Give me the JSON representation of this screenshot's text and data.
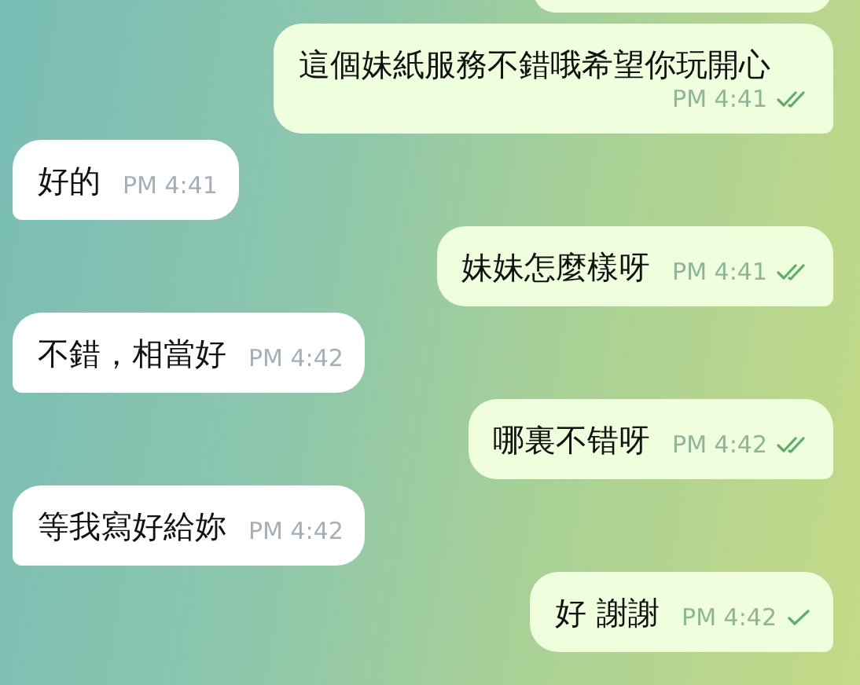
{
  "messages": [
    {
      "kind": "outgoing",
      "text": "這個妹紙服務不錯哦希望你玩開心",
      "time": "PM 4:41",
      "read": true
    },
    {
      "kind": "incoming",
      "text": "好的",
      "time": "PM 4:41"
    },
    {
      "kind": "outgoing",
      "text": "妹妹怎麼樣呀",
      "time": "PM 4:41",
      "read": true
    },
    {
      "kind": "incoming",
      "text": "不錯，相當好",
      "time": "PM 4:42"
    },
    {
      "kind": "outgoing",
      "text": "哪裏不错呀",
      "time": "PM 4:42",
      "read": true
    },
    {
      "kind": "incoming",
      "text": "等我寫好給妳",
      "time": "PM 4:42"
    },
    {
      "kind": "outgoing",
      "text": "好 謝謝",
      "time": "PM 4:42",
      "read": false
    }
  ]
}
